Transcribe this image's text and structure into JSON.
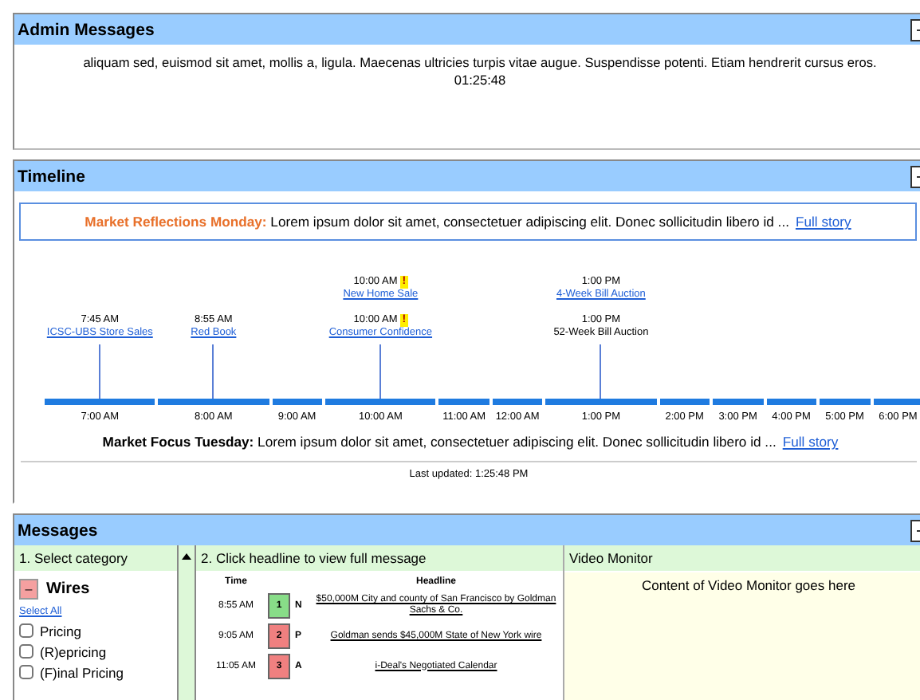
{
  "admin_messages": {
    "title": "Admin Messages",
    "lines": [
      "aliquam sed, euismod sit amet, mollis a, ligula. Maecenas ultricies turpis vitae augue. Suspendisse potenti. Etiam hendrerit cursus eros.",
      "01:25:48"
    ]
  },
  "timeline": {
    "title": "Timeline",
    "headline_box": {
      "label": "Market Reflections Monday:",
      "text": "Lorem ipsum dolor sit amet, consectetuer adipiscing elit. Donec sollicitudin libero id ...",
      "link": "Full story"
    },
    "ticks": [
      {
        "label": "7:00 AM",
        "events": [
          {
            "time": "7:45 AM",
            "name": "ICSC-UBS Store Sales",
            "kind": "link",
            "alert": false
          }
        ]
      },
      {
        "label": "8:00 AM",
        "events": [
          {
            "time": "8:55 AM",
            "name": "Red Book",
            "kind": "link",
            "alert": false
          }
        ]
      },
      {
        "label": "9:00 AM"
      },
      {
        "label": "10:00 AM",
        "events": [
          {
            "time": "10:00 AM",
            "name": "New Home Sale",
            "kind": "link",
            "alert": true
          },
          {
            "time": "10:00 AM",
            "name": "Consumer Confidence",
            "kind": "link",
            "alert": true
          }
        ]
      },
      {
        "label": "11:00 AM"
      },
      {
        "label": "12:00 AM"
      },
      {
        "label": "1:00 PM",
        "events": [
          {
            "time": "1:00 PM",
            "name": "4-Week Bill Auction",
            "kind": "link",
            "alert": false
          },
          {
            "time": "1:00 PM",
            "name": "52-Week Bill Auction",
            "kind": "text",
            "alert": false
          }
        ]
      },
      {
        "label": "2:00 PM"
      },
      {
        "label": "3:00 PM"
      },
      {
        "label": "4:00 PM"
      },
      {
        "label": "5:00 PM"
      },
      {
        "label": "6:00 PM"
      }
    ],
    "alert_mark": "!",
    "focus": {
      "label": "Market Focus Tuesday:",
      "text": "Lorem ipsum dolor sit amet, consectetuer adipiscing elit. Donec sollicitudin libero id ...",
      "link": "Full story"
    },
    "last_updated": "Last updated: 1:25:48 PM"
  },
  "messages": {
    "title": "Messages",
    "category": {
      "heading": "1. Select category",
      "group": "Wires",
      "expanded": true,
      "collapse_mark": "–",
      "select_all": "Select All",
      "items": [
        {
          "label": "Pricing",
          "checked": false
        },
        {
          "label": "(R)epricing",
          "checked": false
        },
        {
          "label": "(F)inal Pricing",
          "checked": false
        }
      ]
    },
    "headlines": {
      "heading": "2. Click headline to view full message",
      "columns": [
        "Time",
        "Headline"
      ],
      "rows": [
        {
          "time": "8:55 AM",
          "number": "1",
          "color": "#88dd88",
          "type": "N",
          "headline": "$50,000M City and county of San Francisco by Goldman Sachs & Co."
        },
        {
          "time": "9:05 AM",
          "number": "2",
          "color": "#f08080",
          "type": "P",
          "headline": "Goldman sends $45,000M State of New York wire"
        },
        {
          "time": "11:05 AM",
          "number": "3",
          "color": "#f08080",
          "type": "A",
          "headline": "i-Deal's Negotiated Calendar"
        }
      ]
    },
    "video": {
      "heading": "Video Monitor",
      "text": "Content of Video Monitor goes here"
    }
  }
}
